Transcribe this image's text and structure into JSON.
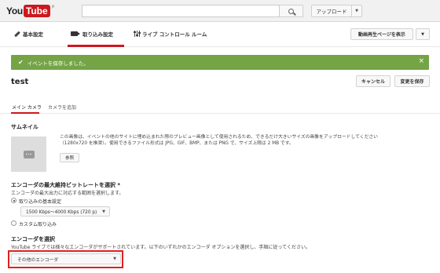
{
  "header": {
    "logo_you": "You",
    "logo_tube": "Tube",
    "logo_cc": "JP",
    "upload_label": "アップロード"
  },
  "tabs": {
    "basic": "基本設定",
    "ingest": "取り込み設定",
    "control_room": "ライブ コントロール ルーム",
    "view_page": "動画再生ページを表示"
  },
  "banner": {
    "message": "イベントを保存しました。",
    "close": "×"
  },
  "event": {
    "title": "test",
    "cancel_label": "キャンセル",
    "save_label": "変更を保存"
  },
  "camera_tabs": {
    "main": "メイン カメラ",
    "add": "カメラを追加"
  },
  "thumbnail": {
    "heading": "サムネイル",
    "desc_line1": "この画像は、イベントの他のサイトに埋め込まれた際のプレビュー画像として使用されるため、できるだけ大きいサイズの画像をアップロードしてください",
    "desc_line2": "（1280x720 を推奨）。使用できるファイル形式は JPG、GIF、BMP、または PNG で、サイズ上限は 2 MB です。",
    "ref_label": "参照"
  },
  "bitrate": {
    "heading": "エンコーダの最大維持ビットレートを選択 *",
    "sub": "エンコーダの最大出力に対応する範囲を選択します。",
    "opt_preset": "取り込みの基本設定",
    "preset_value": "1500 Kbps〜4000 Kbps (720 p)",
    "opt_custom": "カスタム取り込み"
  },
  "encoder": {
    "heading": "エンコーダを選択",
    "sub": "YouTube ライブでは様々なエンコーダがサポートされています。以下のいずれかのエンコーダ オプションを選択し、手順に従ってください。",
    "selected": "その他のエンコーダ"
  },
  "colors": {
    "brand_red": "#cc181e",
    "success_green": "#74a446",
    "highlight_red": "#e02020"
  }
}
